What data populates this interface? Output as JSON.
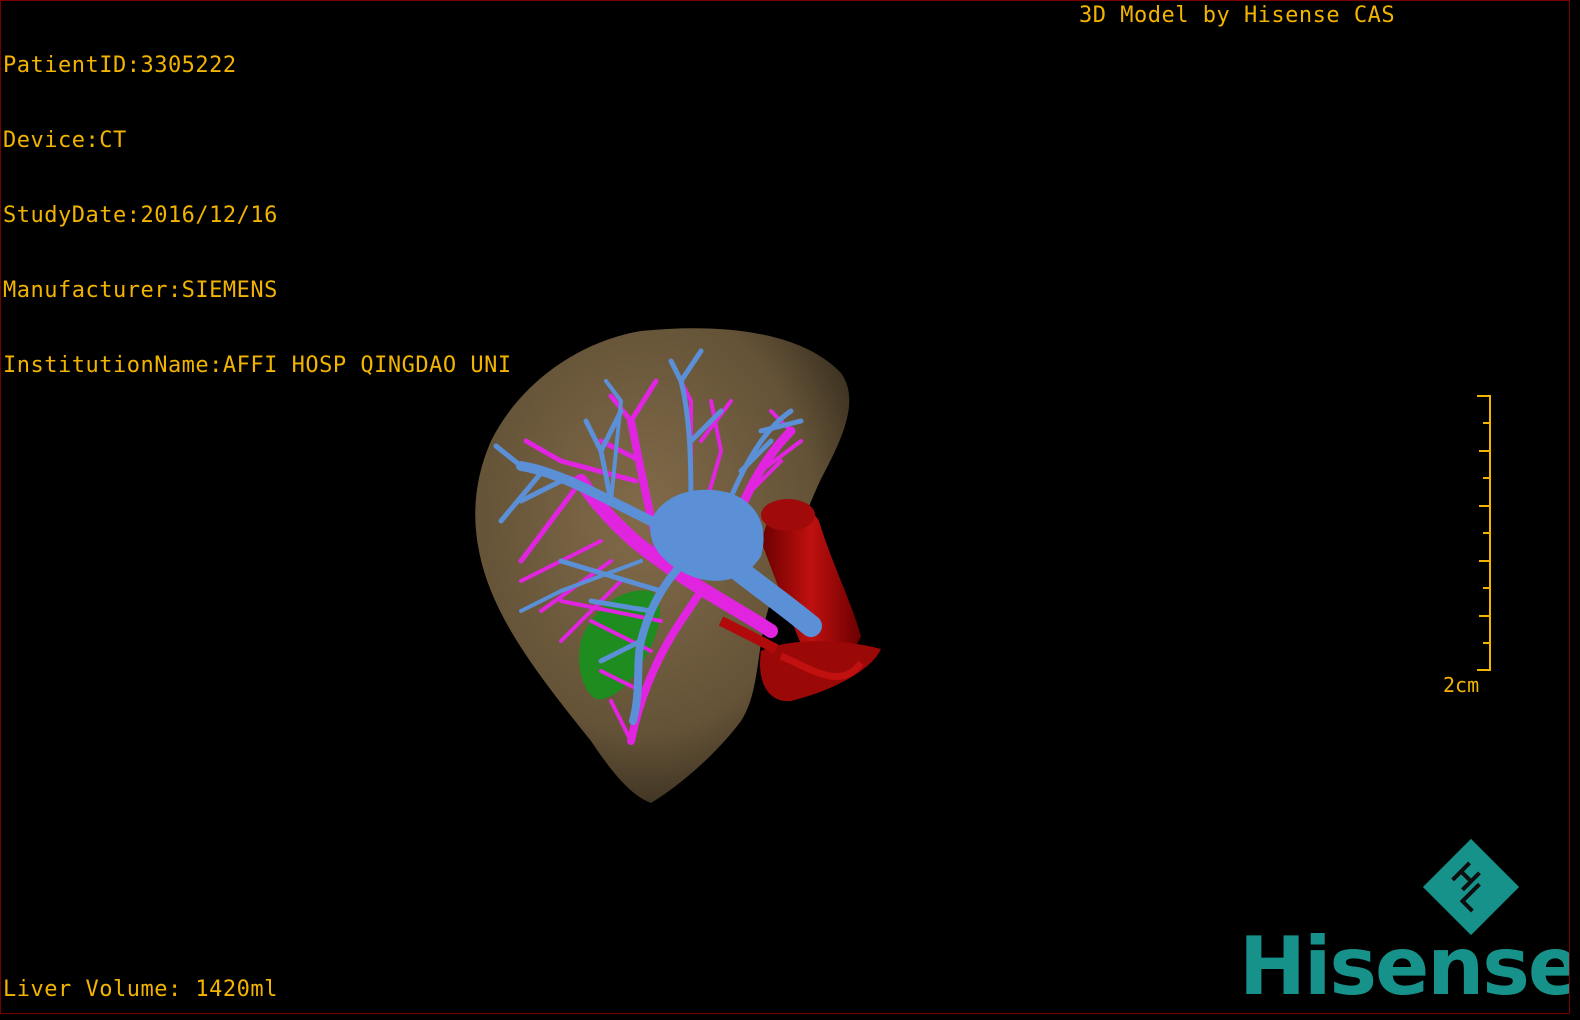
{
  "info": {
    "patient_id": "PatientID:3305222",
    "device": "Device:CT",
    "study_date": "StudyDate:2016/12/16",
    "manufacturer": "Manufacturer:SIEMENS",
    "institution": "InstitutionName:AFFI HOSP QINGDAO UNI"
  },
  "credit": "3D Model by Hisense CAS",
  "liver_volume": "Liver Volume: 1420ml",
  "scale": {
    "label": "2cm"
  },
  "brand": {
    "name": "Hisense",
    "logo_icon": "hisense-diamond-logo-icon"
  },
  "colors": {
    "overlay_text": "#f2b400",
    "liver": "#8a6f48",
    "portal_vein": "#5b8fd6",
    "hepatic_vein": "#e024e0",
    "artery": "#a00a0a",
    "gallbladder": "#1e8c1e",
    "brand": "#16928a"
  }
}
